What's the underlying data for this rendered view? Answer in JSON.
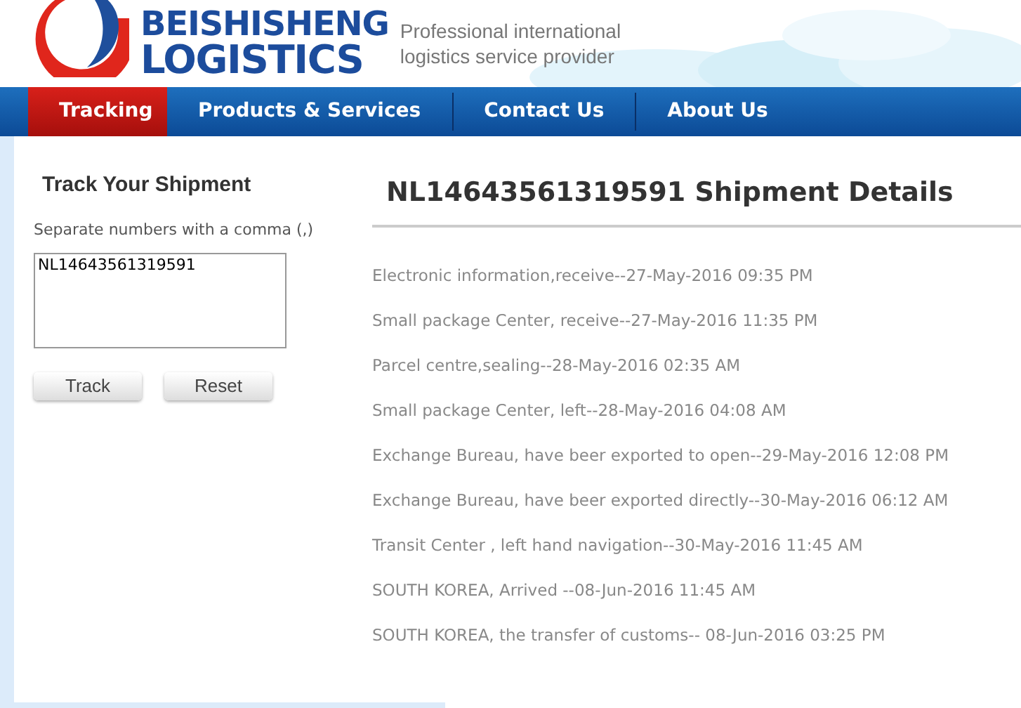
{
  "brand": {
    "name": "BEISHISHENG",
    "name_line2": "LOGISTICS",
    "tagline": "Professional international",
    "tagline_line2": "logistics service provider"
  },
  "nav": [
    {
      "label": "Tracking",
      "selected": true
    },
    {
      "label": "Products & Services",
      "selected": false
    },
    {
      "label": "Contact Us",
      "selected": false
    },
    {
      "label": "About Us",
      "selected": false
    }
  ],
  "sidebar": {
    "title": "Track Your Shipment",
    "hint": "Separate numbers with a comma (,)",
    "tracking_numbers": "NL14643561319591",
    "buttons": [
      "Track",
      "Reset"
    ]
  },
  "details": {
    "title": "NL14643561319591 Shipment Details",
    "events": [
      "Electronic information,receive--27-May-2016 09:35 PM",
      "Small package Center, receive--27-May-2016 11:35 PM",
      "Parcel centre,sealing--28-May-2016 02:35 AM",
      "Small package Center, left--28-May-2016 04:08 AM",
      "Exchange Bureau, have beer exported to open--29-May-2016 12:08 PM",
      "Exchange Bureau, have beer exported directly--30-May-2016 06:12 AM",
      "Transit Center , left hand navigation--30-May-2016 11:45 AM",
      "SOUTH KOREA, Arrived --08-Jun-2016 11:45 AM",
      "SOUTH KOREA, the transfer of customs-- 08-Jun-2016 03:25 PM"
    ]
  }
}
